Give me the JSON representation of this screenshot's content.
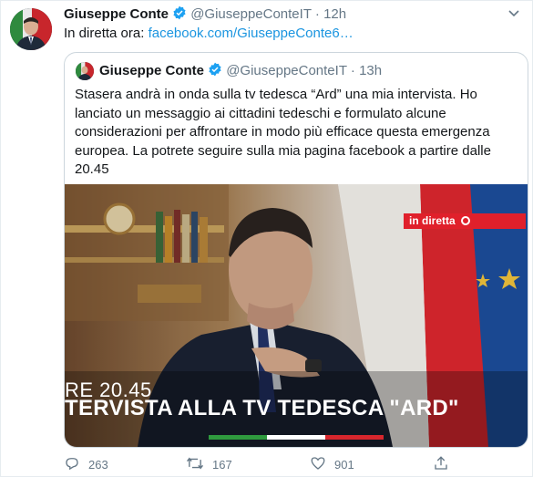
{
  "tweet": {
    "author_name": "Giuseppe Conte",
    "handle": "@GiuseppeConteIT",
    "time": "12h",
    "separator": "·",
    "text_prefix": "In diretta ora: ",
    "link": "facebook.com/GiuseppeConte6…"
  },
  "quoted": {
    "author_name": "Giuseppe Conte",
    "handle": "@GiuseppeConteIT",
    "time": "13h",
    "separator": "·",
    "text": "Stasera andrà in onda sulla tv tedesca “Ard” una mia intervista. Ho lanciato un messaggio ai cittadini tedeschi e formulato alcune considerazioni per affrontare in modo più efficace questa emergenza europea. La potrete seguire sulla mia pagina facebook a partire dalle 20.45",
    "media": {
      "badge": "in diretta",
      "overlay_time": "RE 20.45",
      "overlay_title": "TERVISTA ALLA TV TEDESCA \"ARD\""
    }
  },
  "actions": {
    "reply_count": "263",
    "retweet_count": "167",
    "like_count": "901"
  },
  "colors": {
    "link": "#1b95e0",
    "verified": "#1da1f2",
    "muted": "#657786",
    "badge": "#e0202b"
  }
}
